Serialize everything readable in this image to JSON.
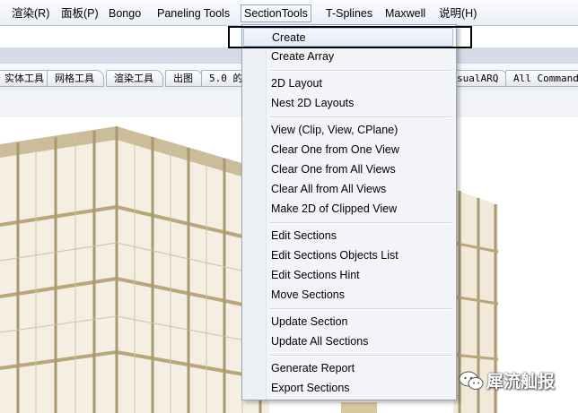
{
  "menubar": {
    "items": [
      {
        "label": "渲染(R)"
      },
      {
        "label": "面板(P)"
      },
      {
        "label": "Bongo"
      },
      {
        "label": "Paneling Tools"
      },
      {
        "label": "SectionTools"
      },
      {
        "label": "T-Splines"
      },
      {
        "label": "Maxwell"
      },
      {
        "label": "说明(H)"
      }
    ],
    "active": "SectionTools"
  },
  "tabs": [
    {
      "label": "实体工具"
    },
    {
      "label": "网格工具"
    },
    {
      "label": "渲染工具"
    },
    {
      "label": "出图"
    },
    {
      "label": "5.0 的"
    },
    {
      "label": "sualARQ"
    },
    {
      "label": "All Commands"
    }
  ],
  "dropdown": {
    "groups": [
      [
        {
          "label": "Create"
        },
        {
          "label": "Create Array"
        }
      ],
      [
        {
          "label": "2D Layout"
        },
        {
          "label": "Nest 2D Layouts"
        }
      ],
      [
        {
          "label": "View (Clip, View, CPlane)"
        },
        {
          "label": "Clear One from One View"
        },
        {
          "label": "Clear One from All  Views"
        },
        {
          "label": "Clear All from All Views"
        },
        {
          "label": "Make 2D of Clipped View"
        }
      ],
      [
        {
          "label": "Edit Sections"
        },
        {
          "label": "Edit Sections Objects List"
        },
        {
          "label": "Edit Sections Hint"
        },
        {
          "label": "Move Sections"
        }
      ],
      [
        {
          "label": "Update Section"
        },
        {
          "label": "Update All Sections"
        }
      ],
      [
        {
          "label": "Generate Report"
        },
        {
          "label": "Export Sections"
        }
      ]
    ],
    "highlighted": "Create"
  },
  "watermark": {
    "text": "犀流舢报",
    "icon": "wechat-icon"
  },
  "colors": {
    "highlight_border": "#a8c0e0",
    "menu_bg": "#f2f4f8",
    "wood": "#e8dcc0",
    "callout": "#000000"
  }
}
